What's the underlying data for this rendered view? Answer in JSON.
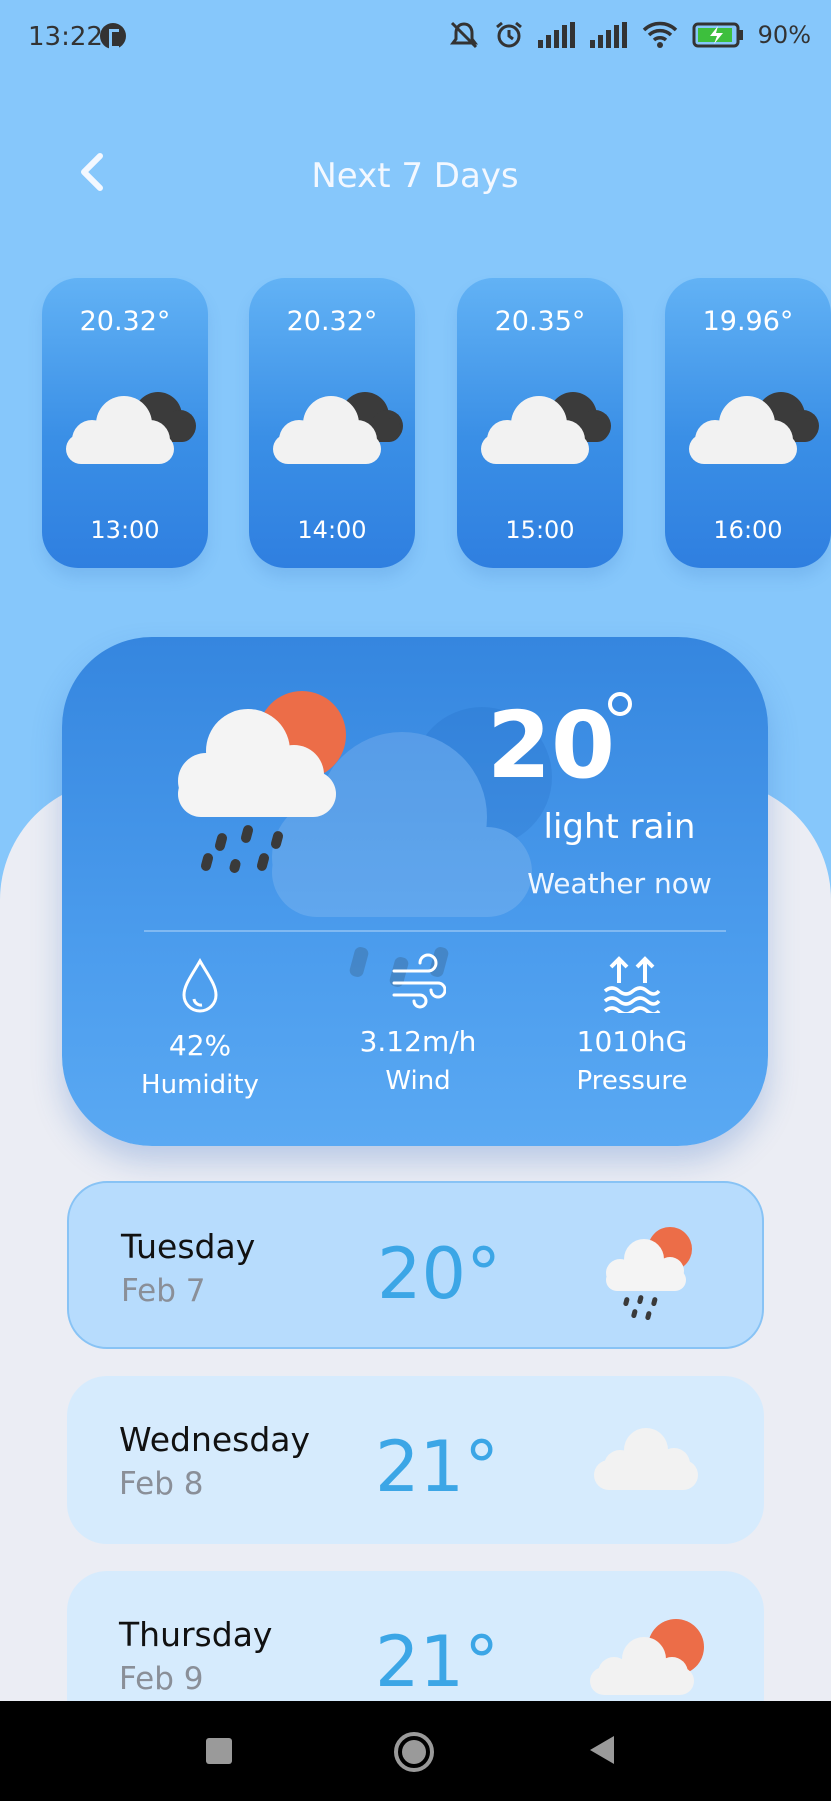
{
  "status_bar": {
    "time": "13:22",
    "battery": "90%"
  },
  "header": {
    "title": "Next 7 Days"
  },
  "hourly": [
    {
      "temp": "20.32°",
      "time": "13:00"
    },
    {
      "temp": "20.32°",
      "time": "14:00"
    },
    {
      "temp": "20.35°",
      "time": "15:00"
    },
    {
      "temp": "19.96°",
      "time": "16:00"
    }
  ],
  "current": {
    "temp": "20",
    "condition": "light rain",
    "subtitle": "Weather now",
    "humidity": {
      "value": "42%",
      "label": "Humidity"
    },
    "wind": {
      "value": "3.12m/h",
      "label": "Wind"
    },
    "pressure": {
      "value": "1010hG",
      "label": "Pressure"
    }
  },
  "daily": [
    {
      "day": "Tuesday",
      "date": "Feb 7",
      "temp": "20°",
      "icon": "rain-sun-cloud-icon"
    },
    {
      "day": "Wednesday",
      "date": "Feb 8",
      "temp": "21°",
      "icon": "cloud-icon"
    },
    {
      "day": "Thursday",
      "date": "Feb 9",
      "temp": "21°",
      "icon": "sun-cloud-icon"
    }
  ],
  "colors": {
    "sky": "#86c7fb",
    "card": "#3586df",
    "accent_temp": "#3ca6e6",
    "sun": "#ec6d48"
  }
}
